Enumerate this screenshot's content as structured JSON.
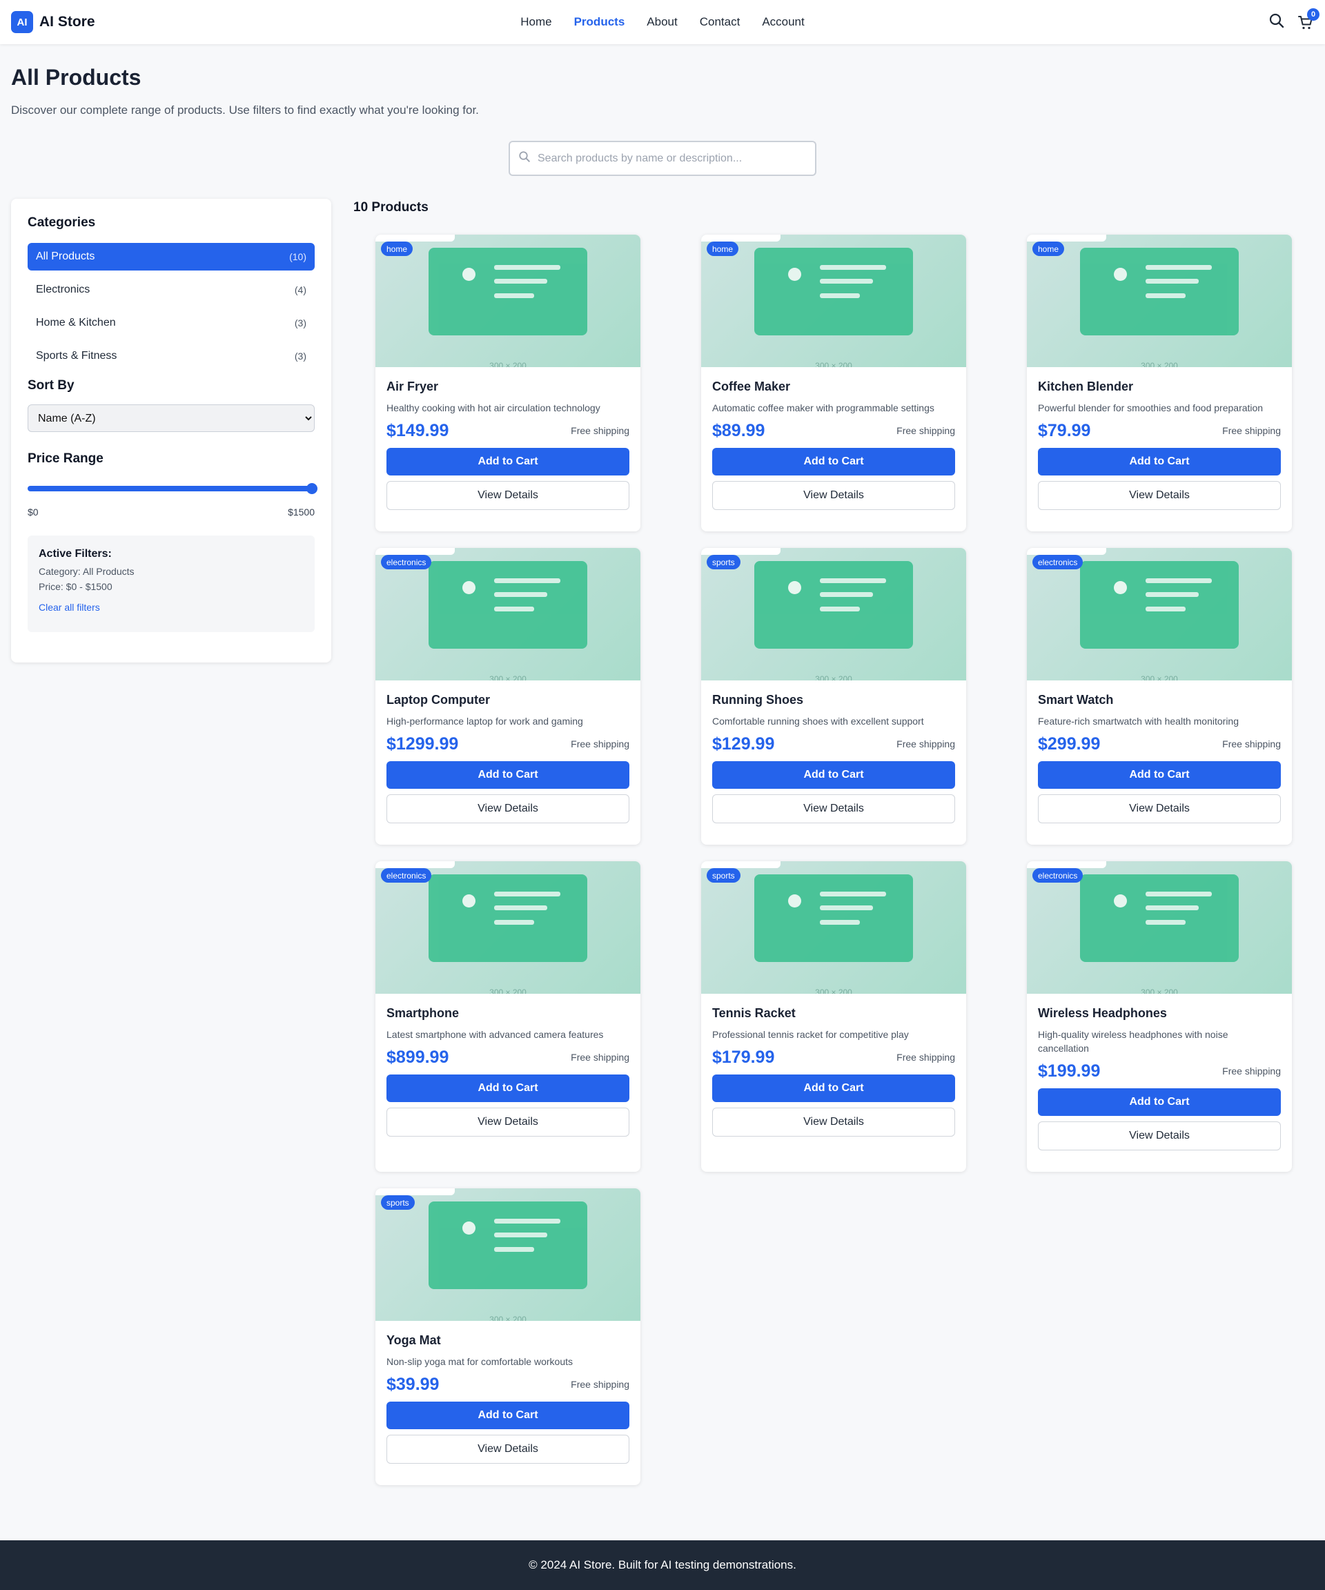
{
  "header": {
    "logo_badge": "AI",
    "logo_text": "AI Store",
    "nav": [
      "Home",
      "Products",
      "About",
      "Contact",
      "Account"
    ],
    "active_nav": "Products",
    "cart_count": "0",
    "icons": [
      "search-icon",
      "cart-icon"
    ],
    "accent_color": "#2563eb"
  },
  "hero": {
    "title": "All Products",
    "subtitle": "Discover our complete range of products. Use filters to find exactly what you're looking for.",
    "search_placeholder": "Search products by name or description..."
  },
  "sidebar": {
    "categories_heading": "Categories",
    "categories": [
      {
        "label": "All Products",
        "count": "(10)",
        "active": true
      },
      {
        "label": "Electronics",
        "count": "(4)",
        "active": false
      },
      {
        "label": "Home & Kitchen",
        "count": "(3)",
        "active": false
      },
      {
        "label": "Sports & Fitness",
        "count": "(3)",
        "active": false
      }
    ],
    "sort_heading": "Sort By",
    "sort_selected": "Name (A-Z)",
    "price_heading": "Price Range",
    "price_min": "$0",
    "price_max": "$1500",
    "price_fill_fraction": 1.0,
    "active_filters": {
      "title": "Active Filters:",
      "category": "Category: All Products",
      "price": "Price: $0 - $1500",
      "clear": "Clear all filters"
    }
  },
  "products_heading": "10 Products",
  "products": [
    {
      "name": "Air Fryer",
      "desc": "Healthy cooking with hot air circulation technology",
      "price": "$149.99",
      "tag": "home"
    },
    {
      "name": "Coffee Maker",
      "desc": "Automatic coffee maker with programmable settings",
      "price": "$89.99",
      "tag": "home"
    },
    {
      "name": "Kitchen Blender",
      "desc": "Powerful blender for smoothies and food preparation",
      "price": "$79.99",
      "tag": "home"
    },
    {
      "name": "Laptop Computer",
      "desc": "High-performance laptop for work and gaming",
      "price": "$1299.99",
      "tag": "electronics"
    },
    {
      "name": "Running Shoes",
      "desc": "Comfortable running shoes with excellent support",
      "price": "$129.99",
      "tag": "sports"
    },
    {
      "name": "Smart Watch",
      "desc": "Feature-rich smartwatch with health monitoring",
      "price": "$299.99",
      "tag": "electronics"
    },
    {
      "name": "Smartphone",
      "desc": "Latest smartphone with advanced camera features",
      "price": "$899.99",
      "tag": "electronics"
    },
    {
      "name": "Tennis Racket",
      "desc": "Professional tennis racket for competitive play",
      "price": "$179.99",
      "tag": "sports"
    },
    {
      "name": "Wireless Headphones",
      "desc": "High-quality wireless headphones with noise cancellation",
      "price": "$199.99",
      "tag": "electronics"
    },
    {
      "name": "Yoga Mat",
      "desc": "Non-slip yoga mat for comfortable workouts",
      "price": "$39.99",
      "tag": "sports"
    }
  ],
  "card_labels": {
    "shipping": "Free shipping",
    "add_to_cart": "Add to Cart",
    "view_details": "View Details",
    "image_caption": "300 × 200"
  },
  "footer": {
    "text": "© 2024 AI Store. Built for AI testing demonstrations."
  }
}
